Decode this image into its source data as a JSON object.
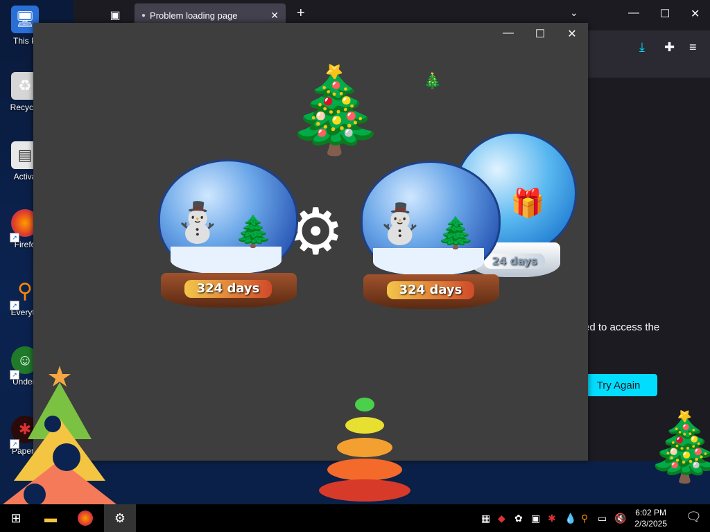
{
  "desktop": {
    "icons": [
      {
        "label": "This P",
        "icon": "computer-icon"
      },
      {
        "label": "Recycle",
        "icon": "recycle-bin-icon"
      },
      {
        "label": "Activa",
        "icon": "document-icon"
      },
      {
        "label": "Firefo",
        "icon": "firefox-icon"
      },
      {
        "label": "Everyth",
        "icon": "search-tool-icon"
      },
      {
        "label": "Undert",
        "icon": "game-icon"
      },
      {
        "label": "Papers",
        "icon": "papers-icon"
      }
    ]
  },
  "browser": {
    "tab_title": "Problem loading page",
    "error_text_fragment": "ed to access the",
    "try_again_label": "Try Again",
    "accent_color": "#00ddff"
  },
  "globes": [
    {
      "label": "324 days"
    },
    {
      "label": "324 days"
    },
    {
      "label": "24 days"
    }
  ],
  "taskbar": {
    "time": "6:02 PM",
    "date": "2/3/2025"
  }
}
